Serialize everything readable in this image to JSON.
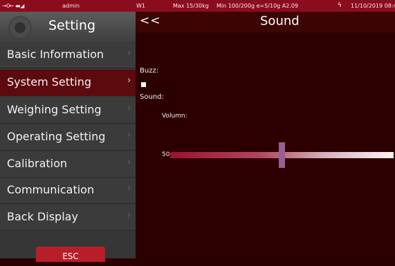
{
  "status_bar": {
    "indicators": "→0← ▬◢",
    "user": "admin",
    "scale": "W1",
    "max": "Max 15/30kg",
    "min": "Min 100/200g e=5/10g A2.09",
    "power_icon": "lightning-icon",
    "datetime": "11/10/2019 08:4"
  },
  "sidebar": {
    "title": "Setting",
    "items": [
      {
        "label": "Basic Information",
        "active": false
      },
      {
        "label": "System Setting",
        "active": true
      },
      {
        "label": "Weighing Setting",
        "active": false
      },
      {
        "label": "Operating Setting",
        "active": false
      },
      {
        "label": "Calibration",
        "active": false
      },
      {
        "label": "Communication",
        "active": false
      },
      {
        "label": "Back Display",
        "active": false
      }
    ],
    "chevron": "›",
    "esc_label": "ESC"
  },
  "main": {
    "back_label": "<<",
    "title": "Sound",
    "buzz_label": "Buzz:",
    "buzz_checked": false,
    "sound_label": "Sound:",
    "volume_label": "Volumn:",
    "volume_value": "50",
    "volume_fraction": 0.5
  },
  "colors": {
    "status_bar": "#8a0d1e",
    "sidebar": "#3b3b3b",
    "active_item": "#5d0a0f",
    "main_bg": "#2d0000",
    "esc_button": "#b81e2a",
    "slider_thumb": "#9a5f92"
  }
}
